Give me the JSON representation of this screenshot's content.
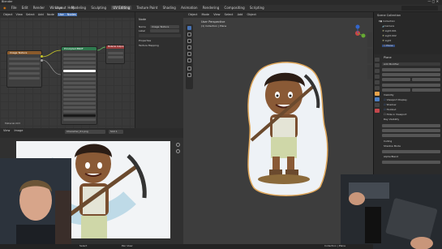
{
  "app": {
    "title": "Blender"
  },
  "menu": [
    "File",
    "Edit",
    "Render",
    "Window",
    "Help"
  ],
  "workspace_tabs": [
    "Layout",
    "Modeling",
    "Sculpting",
    "UV Editing",
    "Texture Paint",
    "Shading",
    "Animation",
    "Rendering",
    "Compositing",
    "Scripting"
  ],
  "active_tab": "UV Editing",
  "node_editor": {
    "header_items": [
      "Object",
      "View",
      "Select",
      "Add",
      "Node",
      "Use Nodes"
    ],
    "image_node_title": "Image Texture",
    "bsdf_title": "Principled BSDF",
    "output_title": "Material Output",
    "material_label": "Material.003"
  },
  "n_panel": {
    "section_node": "Node",
    "name_label": "Name",
    "name_value": "Image Texture",
    "label_label": "Label",
    "properties": "Properties",
    "texture_mapping": "Texture Mapping"
  },
  "viewport": {
    "header_items": [
      "Object Mode",
      "View",
      "Select",
      "Add",
      "Object"
    ],
    "overlay_text_1": "User Perspective",
    "overlay_text_2": "(1) Collection | Plane",
    "side_tabs": [
      "Item",
      "Tool",
      "View"
    ]
  },
  "outliner": {
    "header": "Scene Collection",
    "items": [
      "Collection",
      "Camera",
      "Light.001",
      "Light.002",
      "Light",
      "Plane"
    ]
  },
  "properties": {
    "object_name": "Plane",
    "modifier_name": "Add Modifier",
    "rows": [
      "Visibility",
      "Viewport Display",
      "Shadow",
      "Holdout",
      "Hide in Viewport",
      "Ray Visibility",
      "Culling",
      "Shadow Mode",
      "Alpha Blend"
    ]
  },
  "image_editor": {
    "header_items": [
      "View",
      "Image"
    ],
    "image_name": "Character_01.png",
    "slot": "Slot 1"
  },
  "status": {
    "left": "Select",
    "center": "Pan View",
    "right": "Collection | Plane"
  },
  "colors": {
    "accent": "#4772b3",
    "image_node": "#8a5a2b",
    "bsdf_node": "#2f7a4f",
    "output_node": "#9c3a3a",
    "link": "#c7c729"
  }
}
